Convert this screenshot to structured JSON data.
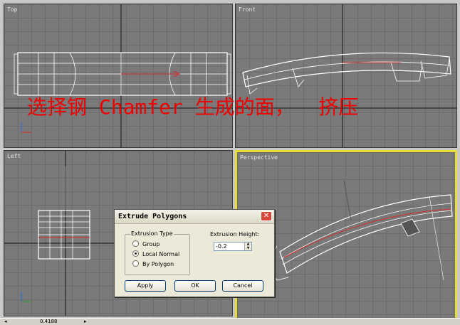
{
  "viewports": {
    "top": "Top",
    "front": "Front",
    "left": "Left",
    "perspective": "Perspective"
  },
  "overlay_caption": "选择钢 Chamfer 生成的面，  挤压",
  "dialog": {
    "title": "Extrude Polygons",
    "group_title": "Extrusion Type",
    "options": [
      "Group",
      "Local Normal",
      "By Polygon"
    ],
    "selected_option": "Local Normal",
    "height_label": "Extrusion Height:",
    "height_value": "-0.2",
    "buttons": {
      "apply": "Apply",
      "ok": "OK",
      "cancel": "Cancel"
    }
  },
  "statusbar": {
    "value": "0.4188"
  },
  "colors": {
    "active_border": "#e8dc3a",
    "caption": "#f20000",
    "wire": "#ffffff",
    "selection": "#d92a2a"
  }
}
